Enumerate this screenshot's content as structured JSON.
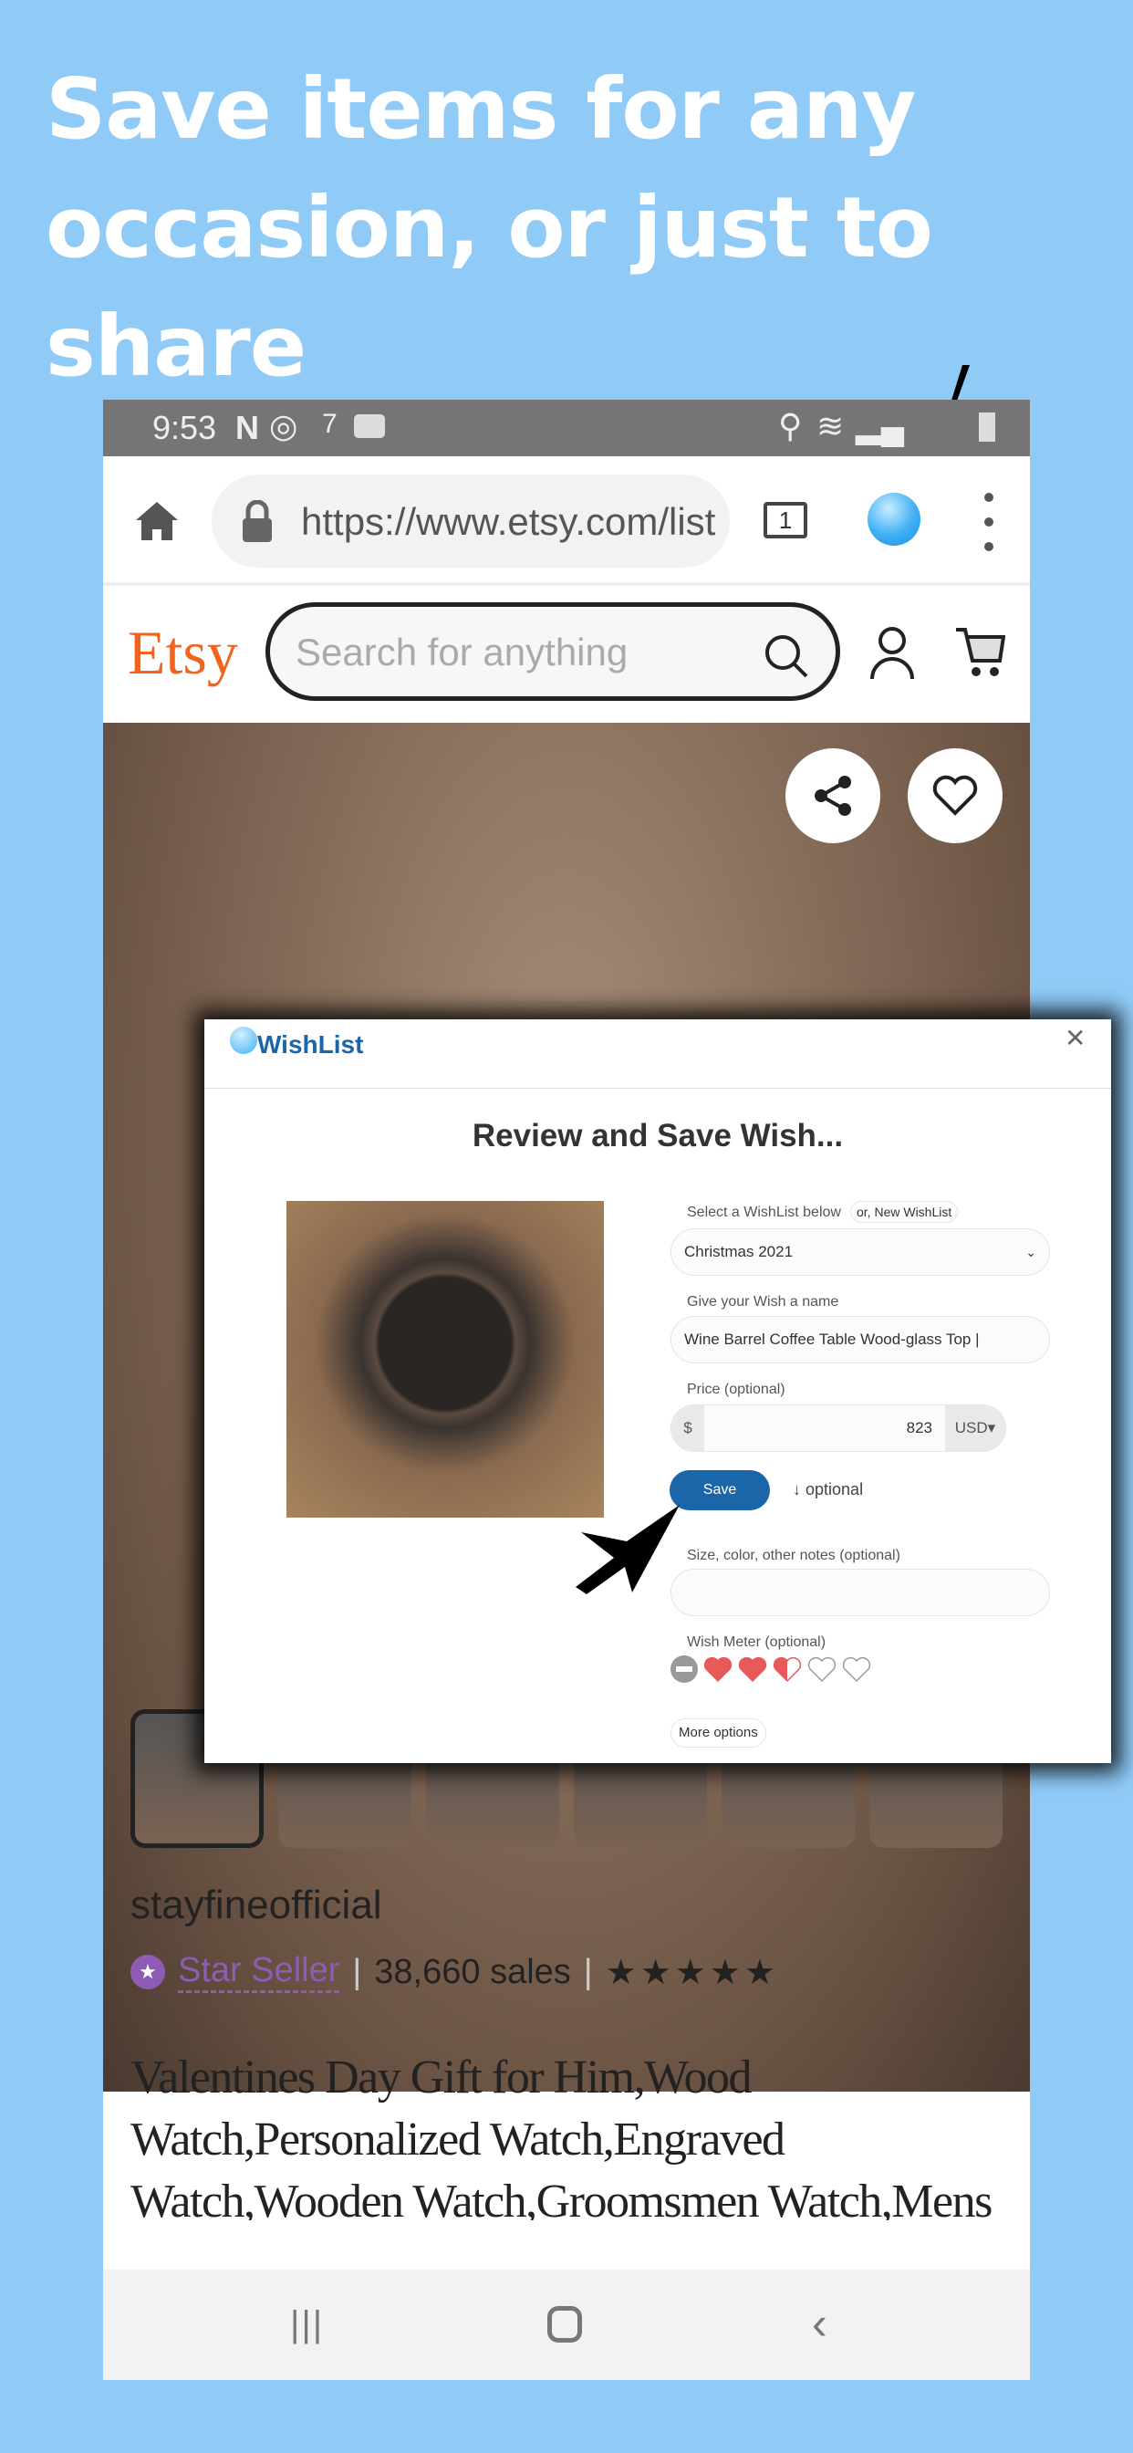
{
  "headline": [
    "Save items for any",
    "occasion, or just to share"
  ],
  "status_bar": {
    "time": "9:53",
    "notif_count": "7"
  },
  "browser": {
    "url": "https://www.etsy.com/list",
    "tab_count": "1"
  },
  "etsy": {
    "logo": "Etsy",
    "search_placeholder": "Search for anything",
    "brand_color": "#f1641e"
  },
  "listing": {
    "shop_name": "stayfineofficial",
    "badge": "Star Seller",
    "sales": "38,660 sales",
    "rating": 5,
    "title": "Valentines Day Gift for Him,Wood Watch,Personalized Watch,Engraved Watch,Wooden Watch,Groomsmen Watch,Mens Watch,Boyfriend Gift,Gift"
  },
  "popup": {
    "logo": "WishList",
    "heading": "Review and Save Wish...",
    "select_label": "Select a WishList below",
    "new_list_button": "or, New WishList",
    "selected_list": "Christmas 2021",
    "name_label": "Give your Wish a name",
    "name_value": "Wine Barrel Coffee Table  Wood-glass Top |",
    "price_label": "Price (optional)",
    "currency_symbol": "$",
    "price_value": "823",
    "currency": "USD",
    "save_button": "Save",
    "optional_toggle": "optional",
    "notes_label": "Size, color, other notes (optional)",
    "notes_value": "",
    "meter_label": "Wish Meter (optional)",
    "wish_meter_value": 2.5,
    "wish_meter_max": 5,
    "more_options": "More options",
    "accent": "#1a66a8"
  }
}
